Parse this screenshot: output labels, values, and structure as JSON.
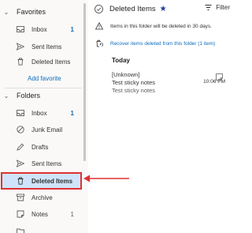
{
  "sidebar": {
    "favorites": {
      "label": "Favorites",
      "items": [
        {
          "label": "Inbox",
          "count": "1"
        },
        {
          "label": "Sent Items"
        },
        {
          "label": "Deleted Items"
        }
      ],
      "add_favorite": "Add favorite"
    },
    "folders": {
      "label": "Folders",
      "items": [
        {
          "label": "Inbox",
          "count": "1"
        },
        {
          "label": "Junk Email"
        },
        {
          "label": "Drafts"
        },
        {
          "label": "Sent Items"
        },
        {
          "label": "Deleted Items"
        },
        {
          "label": "Archive"
        },
        {
          "label": "Notes",
          "count": "1"
        }
      ]
    }
  },
  "main": {
    "title": "Deleted Items",
    "filter_label": "Filter",
    "info_text": "Items in this folder will be deleted in 30 days.",
    "recover_text": "Recover items deleted from this folder (1 item)",
    "group_header": "Today",
    "messages": [
      {
        "sender": "[Unknown]",
        "subject": "Test sticky notes",
        "time": "10:06 PM",
        "preview": "Test sticky notes"
      }
    ]
  },
  "colors": {
    "accent": "#0f6cbd",
    "selected_bg": "#cfe4fa",
    "highlight_border": "#e03131",
    "star": "#1f3a93"
  }
}
